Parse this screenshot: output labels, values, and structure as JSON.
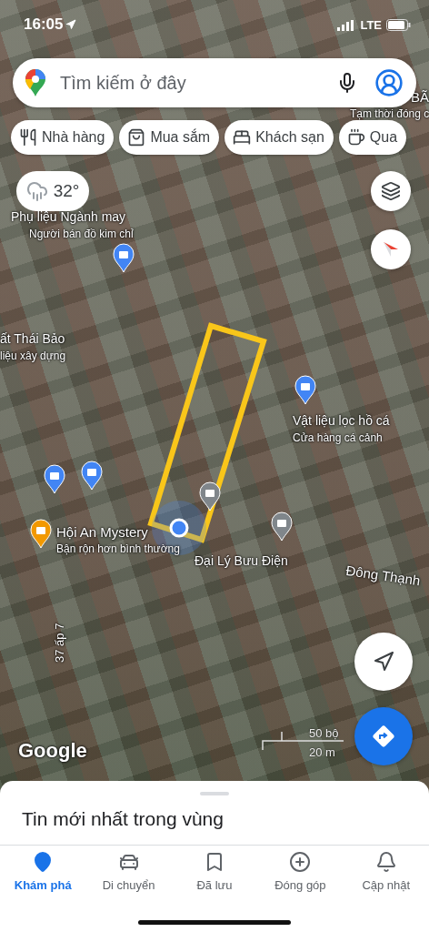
{
  "status_bar": {
    "time": "16:05",
    "network": "LTE"
  },
  "search": {
    "placeholder": "Tìm kiếm ở đây"
  },
  "chips": [
    {
      "label": "Nhà hàng",
      "kind": "restaurant"
    },
    {
      "label": "Mua sắm",
      "kind": "shopping"
    },
    {
      "label": "Khách sạn",
      "kind": "hotel"
    },
    {
      "label": "Qua",
      "kind": "cafe"
    }
  ],
  "weather": {
    "temperature": "32°"
  },
  "map_labels": [
    {
      "title": "BÃ"
    },
    {
      "subtitle": "Tạm thời đóng c"
    },
    {
      "title": "Phụ liệu Ngành may",
      "subtitle": "Người bán đồ kim chỉ"
    },
    {
      "title": "ất Thái Bảo",
      "subtitle": "liệu xây dựng"
    },
    {
      "title": "Vật liệu lọc hồ cá",
      "subtitle": "Cửa hàng cá cảnh"
    },
    {
      "title": "Hội An Mystery",
      "subtitle": "Bận rộn hơn bình thường"
    },
    {
      "title": "Đại Lý Bưu Điện"
    },
    {
      "title": "Đông Thạnh"
    },
    {
      "title": "37 ấp 7"
    }
  ],
  "attribution": "Google",
  "scale": {
    "imperial": "50 bộ",
    "metric": "20 m"
  },
  "sheet": {
    "title": "Tin mới nhất trong vùng"
  },
  "nav": [
    {
      "label": "Khám phá",
      "kind": "explore",
      "selected": true
    },
    {
      "label": "Di chuyển",
      "kind": "commute",
      "selected": false
    },
    {
      "label": "Đã lưu",
      "kind": "saved",
      "selected": false
    },
    {
      "label": "Đóng góp",
      "kind": "contribute",
      "selected": false
    },
    {
      "label": "Cập nhật",
      "kind": "updates",
      "selected": false
    }
  ]
}
